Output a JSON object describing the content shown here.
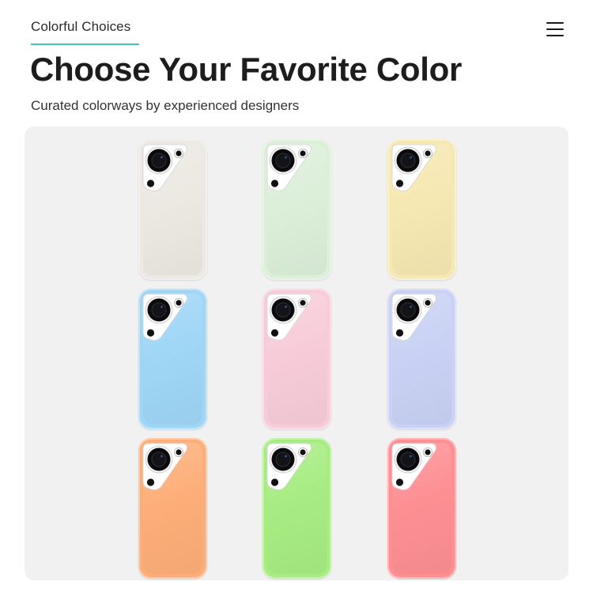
{
  "header": {
    "eyebrow": "Colorful Choices",
    "accent_color": "#3fc7b4",
    "menu_icon": "hamburger-menu-icon"
  },
  "hero": {
    "title": "Choose Your Favorite Color",
    "subtitle": "Curated colorways by experienced designers"
  },
  "gallery": {
    "cases": [
      {
        "name": "phone-case-ivory",
        "color": "#ece8e2"
      },
      {
        "name": "phone-case-mint",
        "color": "#dcefd9"
      },
      {
        "name": "phone-case-butter",
        "color": "#f6e8b2"
      },
      {
        "name": "phone-case-sky-blue",
        "color": "#9fd6f6"
      },
      {
        "name": "phone-case-pink",
        "color": "#f7ccd8"
      },
      {
        "name": "phone-case-lavender",
        "color": "#c9d2f4"
      },
      {
        "name": "phone-case-orange",
        "color": "#fdae78"
      },
      {
        "name": "phone-case-lime",
        "color": "#a7ec82"
      },
      {
        "name": "phone-case-coral",
        "color": "#fd8f93"
      }
    ]
  }
}
